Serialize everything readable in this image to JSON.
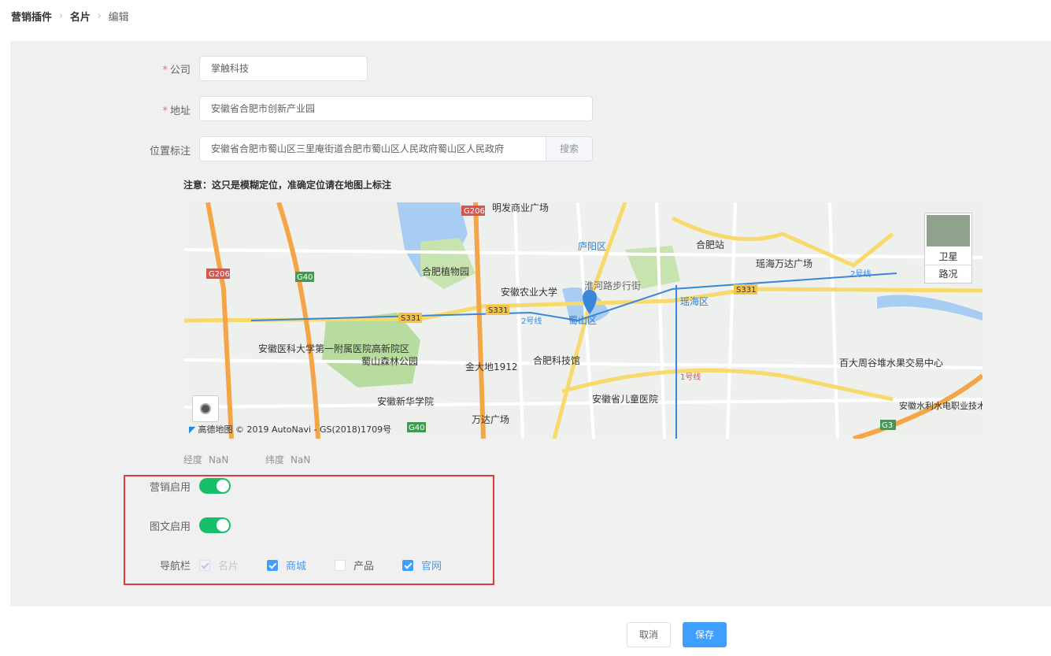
{
  "breadcrumb": [
    "营销插件",
    "名片",
    "编辑"
  ],
  "form": {
    "company": {
      "label": "公司",
      "value": "掌触科技"
    },
    "address": {
      "label": "地址",
      "value": "安徽省合肥市创新产业园"
    },
    "location": {
      "label": "位置标注",
      "value": "安徽省合肥市蜀山区三里庵街道合肥市蜀山区人民政府蜀山区人民政府",
      "search_label": "搜索"
    },
    "note": "注意：这只是模糊定位，准确定位请在地图上标注"
  },
  "map": {
    "satellite_label": "卫星",
    "traffic_label": "路况",
    "attribution": "高德地图 © 2019 AutoNavi - GS(2018)1709号",
    "places": [
      "明发商业广场",
      "合肥站",
      "瑶海万达广场",
      "合肥植物园",
      "庐阳区",
      "淮河路步行街",
      "安徽农业大学",
      "瑶海区",
      "蜀山区",
      "安徽医科大学第一附属医院高新院区",
      "蜀山森林公园",
      "金大地1912",
      "合肥科技馆",
      "百大周谷堆水果交易中心",
      "安徽新华学院",
      "安徽省儿童医院",
      "万达广场",
      "安徽水利水电职业技术学",
      "2号线",
      "1号线"
    ],
    "roads": [
      "G206",
      "G40",
      "S331",
      "G3"
    ]
  },
  "coords": {
    "lng_label": "经度",
    "lng_value": "NaN",
    "lat_label": "纬度",
    "lat_value": "NaN"
  },
  "toggles": {
    "marketing": {
      "label": "营销启用",
      "on": true
    },
    "graphic": {
      "label": "图文启用",
      "on": true
    }
  },
  "nav": {
    "label": "导航栏",
    "items": [
      {
        "label": "名片",
        "checked": true,
        "disabled": true
      },
      {
        "label": "商城",
        "checked": true,
        "disabled": false
      },
      {
        "label": "产品",
        "checked": false,
        "disabled": false
      },
      {
        "label": "官网",
        "checked": true,
        "disabled": false
      }
    ]
  },
  "actions": {
    "cancel": "取消",
    "save": "保存"
  },
  "colors": {
    "primary": "#409eff",
    "switch_on": "#19be6b",
    "highlight": "#e4393c",
    "required": "#f56c6c"
  }
}
